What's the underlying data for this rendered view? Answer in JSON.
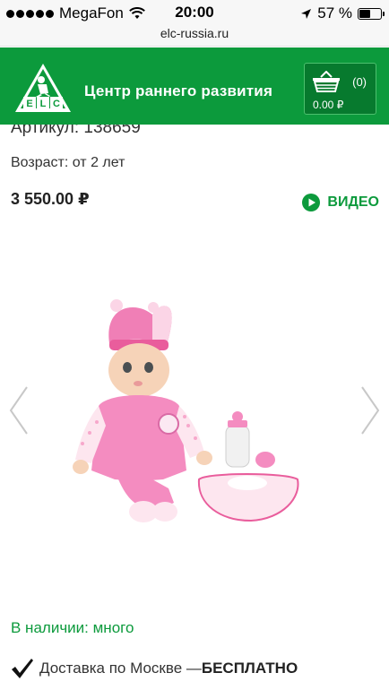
{
  "status_bar": {
    "carrier": "MegaFon",
    "time": "20:00",
    "battery": "57 %",
    "battery_level": 0.57
  },
  "browser": {
    "url": "elc-russia.ru"
  },
  "header": {
    "logo_letters": [
      "E",
      "L",
      "C"
    ],
    "title": "Центр раннего развития",
    "cart_count": "(0)",
    "cart_total": "0.00 ₽"
  },
  "product": {
    "article": "Артикул: 138659",
    "age": "Возраст: от 2 лет",
    "price": "3 550.00 ₽",
    "video_label": "ВИДЕО",
    "stock": "В наличии: много",
    "delivery_text": "Доставка по Москве — ",
    "delivery_free": "БЕСПЛАТНО"
  },
  "colors": {
    "brand_green": "#0c9a3c",
    "cart_green": "#077a2e"
  },
  "icons": [
    "signal-dots-icon",
    "wifi-icon",
    "location-arrow-icon",
    "battery-icon",
    "elc-logo-icon",
    "basket-icon",
    "play-icon",
    "chevron-left-icon",
    "chevron-right-icon",
    "check-icon"
  ]
}
